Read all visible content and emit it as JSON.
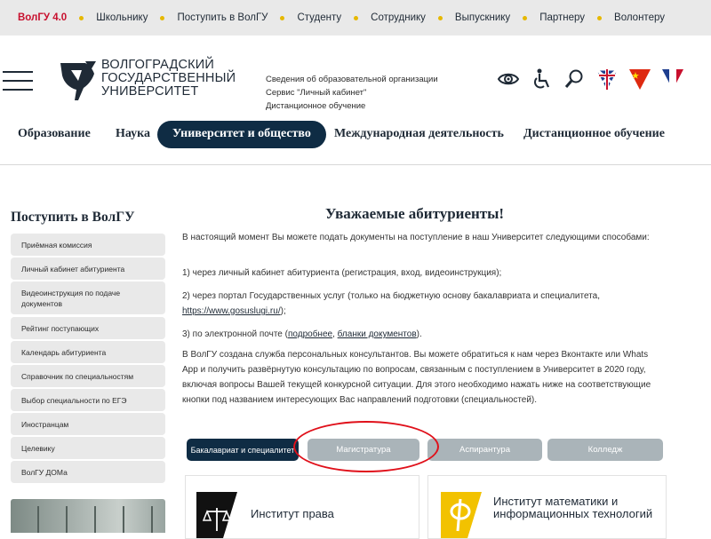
{
  "topbar": {
    "items": [
      "ВолГУ 4.0",
      "Школьнику",
      "Поступить в ВолГУ",
      "Студенту",
      "Сотруднику",
      "Выпускнику",
      "Партнеру",
      "Волонтеру"
    ]
  },
  "header": {
    "logo_lines": [
      "ВОЛГОГРАДСКИЙ",
      "ГОСУДАРСТВЕННЫЙ",
      "УНИВЕРСИТЕТ"
    ],
    "info_links": [
      "Сведения об образовательной организации",
      "Сервис \"Личный кабинет\"",
      "Дистанционное обучение"
    ],
    "icons": [
      "visually-impaired-eye-icon",
      "accessibility-wheelchair-icon",
      "search-icon",
      "flag-uk-icon",
      "flag-china-icon",
      "flag-france-icon"
    ]
  },
  "nav": {
    "items": [
      "Образование",
      "Наука",
      "Университет и общество",
      "Международная деятельность",
      "Дистанционное обучение"
    ],
    "active_index": 2
  },
  "sidebar": {
    "title": "Поступить в ВолГУ",
    "items": [
      "Приёмная комиссия",
      "Личный кабинет абитуриента",
      "Видеоинструкция по подаче документов",
      "Рейтинг поступающих",
      "Календарь абитуриента",
      "Справочник по специальностям",
      "Выбор специальности по ЕГЭ",
      "Иностранцам",
      "Целевику",
      "ВолГУ ДОМа"
    ]
  },
  "content": {
    "heading": "Уважаемые абитуриенты!",
    "intro": "В настоящий момент Вы можете подать документы на поступление в наш Университет следующими способами:",
    "option1": "1) через личный кабинет абитуриента (регистрация, вход, видеоинструкция);",
    "option2_prefix": "2) через портал Государственных услуг (только на бюджетную основу бакалавриата и специалитета, ",
    "option2_link": "https://www.gosuslugi.ru/",
    "option2_suffix": ");",
    "option3_prefix": "3) по электронной почте (",
    "option3_link1": "подробнее",
    "option3_sep": ", ",
    "option3_link2": "бланки документов",
    "option3_suffix": ").",
    "consult": "В ВолГУ создана служба персональных консультантов. Вы можете обратиться к нам через Вконтакте или Whats App и получить развёрнутую консультацию по вопросам, связанным с поступлением в Университет в 2020 году, включая вопросы Вашей текущей конкурсной ситуации. Для этого необходимо нажать ниже на соответствующие кнопки под названием интересующих Вас направлений подготовки (специальностей)."
  },
  "tabs": {
    "items": [
      "Бакалавриат и специалитет",
      "Магистратура",
      "Аспирантура",
      "Колледж"
    ],
    "active_index": 0,
    "highlighted_index": 1,
    "highlight_color": "#e0101a"
  },
  "cards": [
    {
      "title": "Институт права",
      "icon": "law-scales-icon"
    },
    {
      "title": "Институт математики и информационных технологий",
      "icon": "phi-letter-icon"
    }
  ],
  "colors": {
    "brand_navy": "#0f2c44",
    "brand_red": "#c8102e",
    "accent_yellow": "#e6b800",
    "tab_inactive": "#aab4b9"
  }
}
